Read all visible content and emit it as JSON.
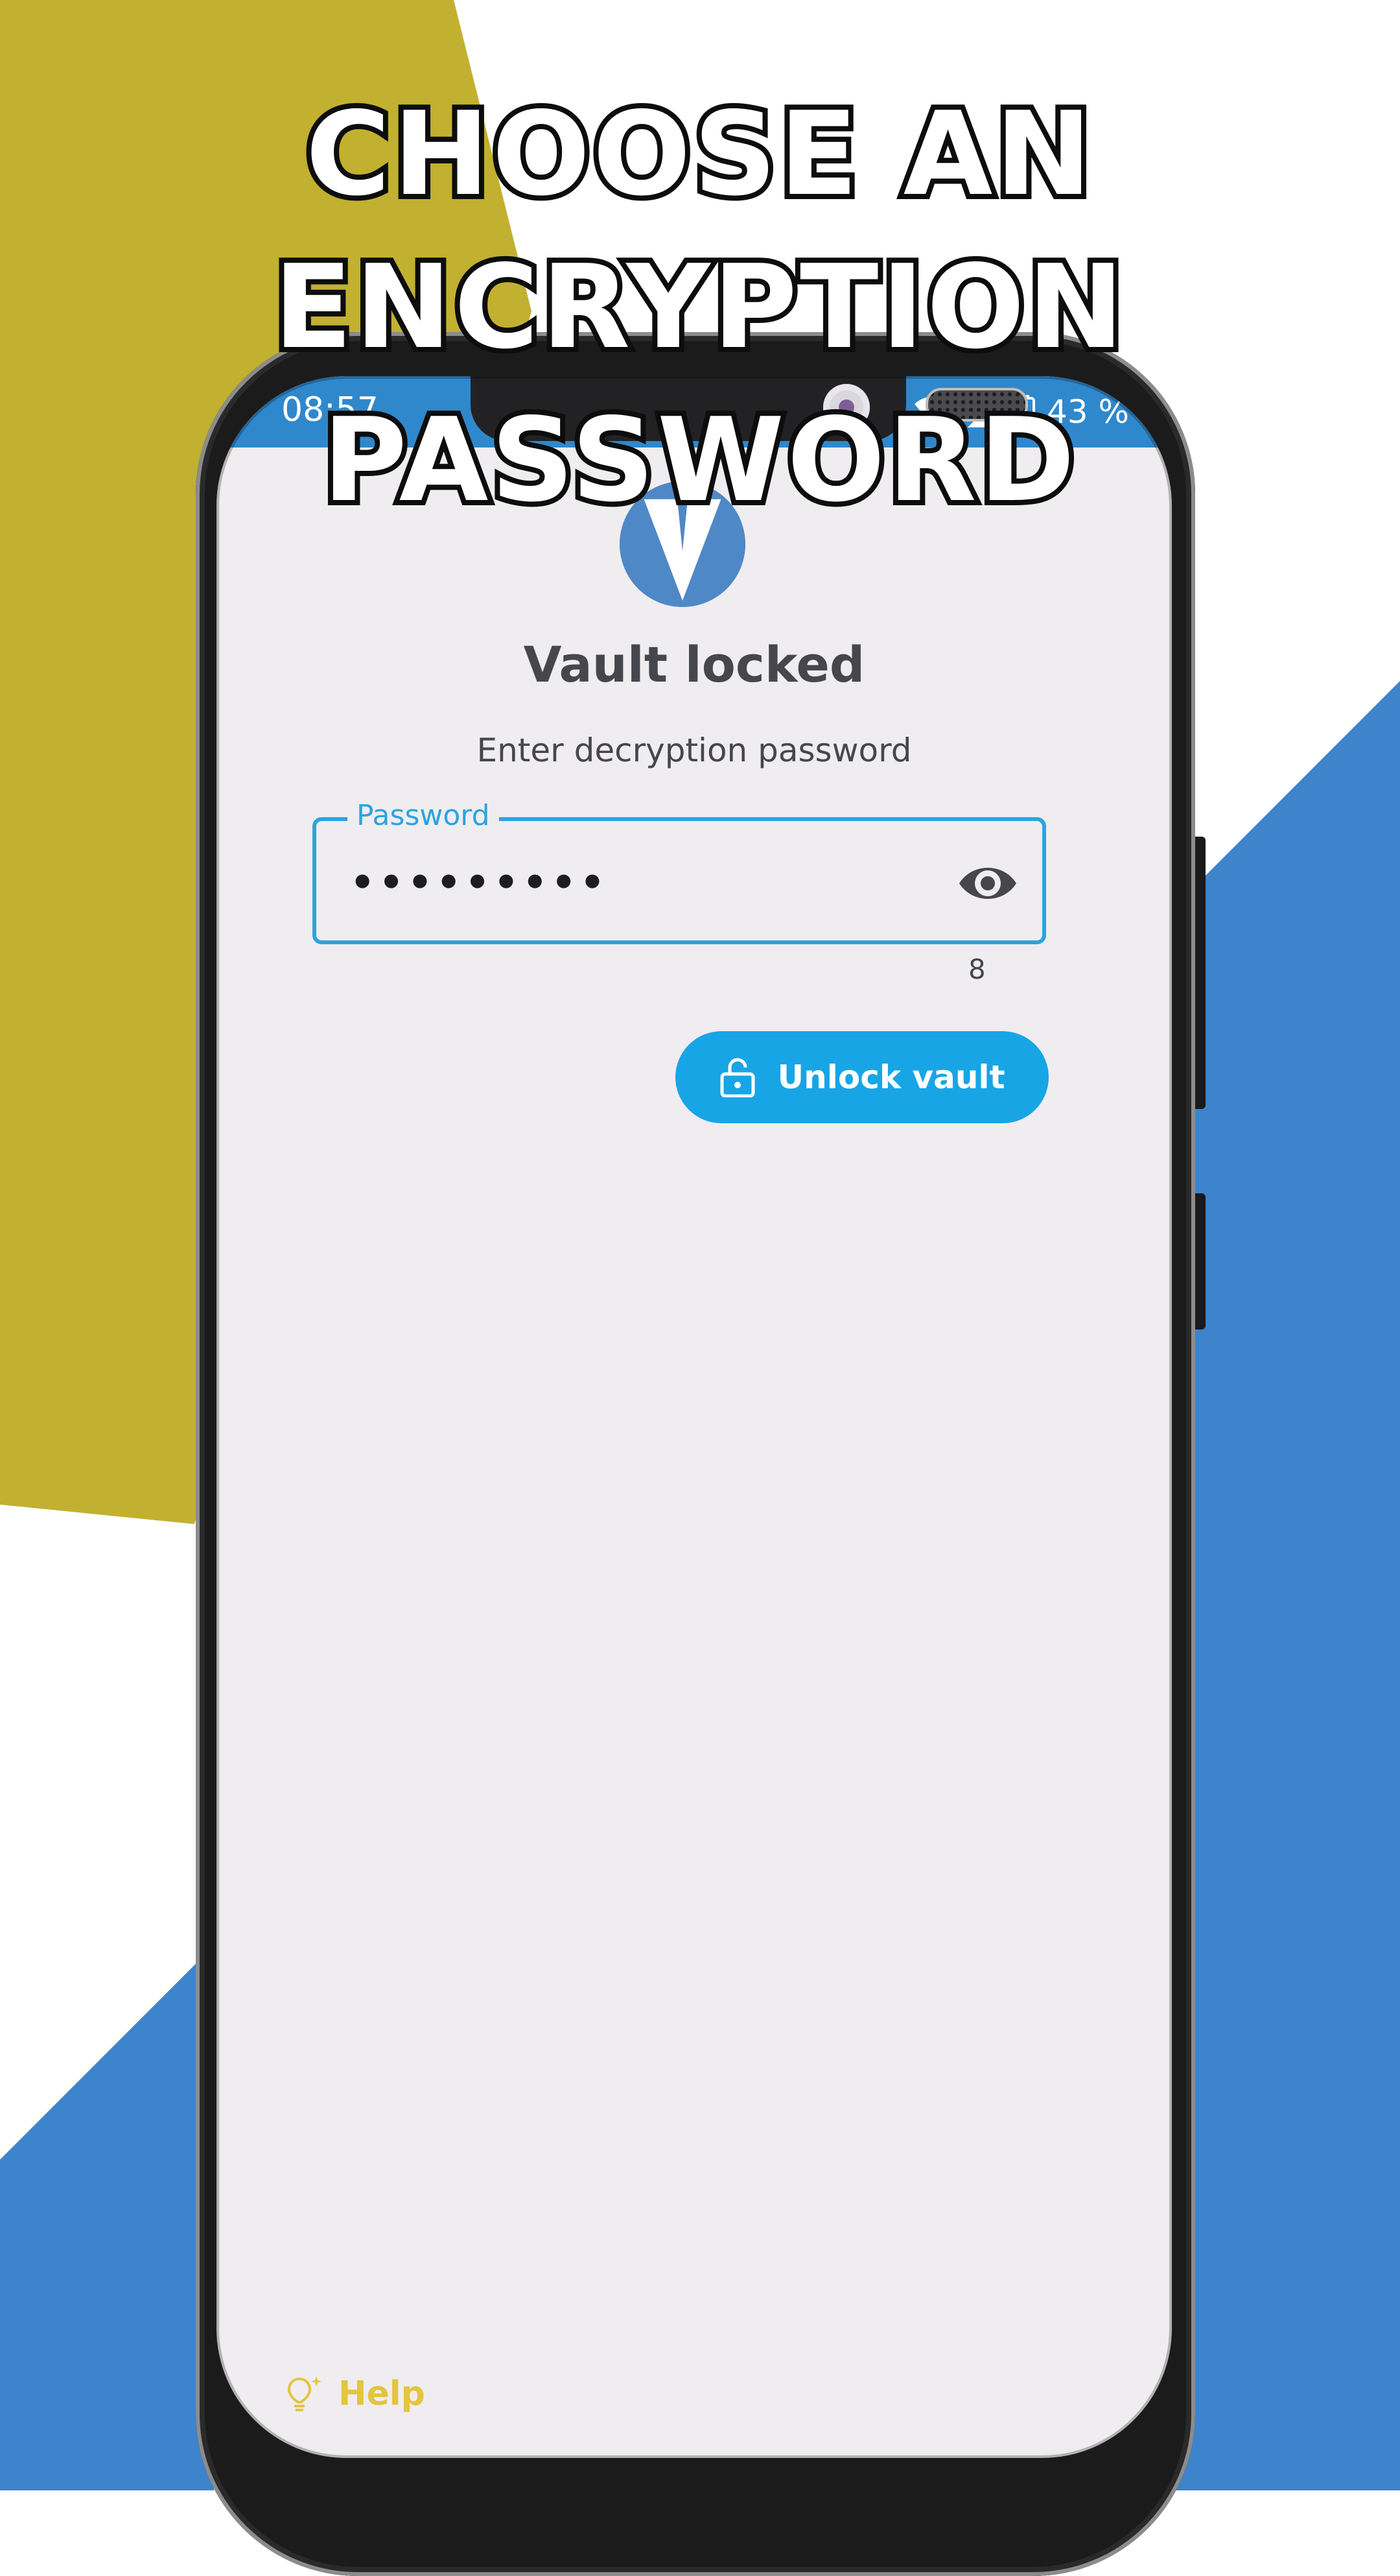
{
  "headline": {
    "line1": "CHOOSE AN ENCRYPTION",
    "line2": "PASSWORD"
  },
  "colors": {
    "olive_bg": "#c2b030",
    "blue_bg": "#3d84cc",
    "status_bar": "#2f88cc",
    "accent": "#18a5e6",
    "help": "#e3c53e"
  },
  "status_bar": {
    "time": "08:57",
    "battery": "43 %",
    "icons": [
      "wifi-icon",
      "signal-icon",
      "battery-icon"
    ]
  },
  "app": {
    "logo_icon": "vault-logo-icon",
    "title": "Vault locked",
    "subtitle": "Enter decryption password",
    "password_field": {
      "label": "Password",
      "value": "•••••••••",
      "toggle_icon": "eye-icon"
    },
    "char_count": "8",
    "unlock_button": {
      "label": "Unlock vault",
      "icon": "lock-icon"
    },
    "help": {
      "label": "Help",
      "icon": "lightbulb-icon"
    }
  }
}
